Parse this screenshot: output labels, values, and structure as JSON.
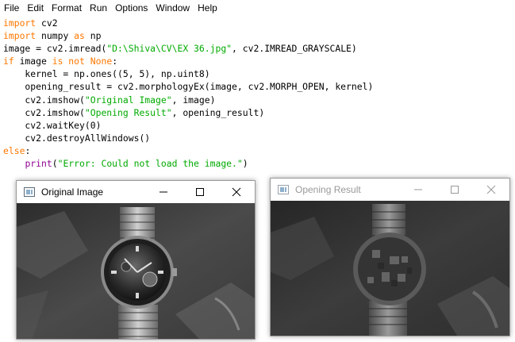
{
  "menubar": [
    "File",
    "Edit",
    "Format",
    "Run",
    "Options",
    "Window",
    "Help"
  ],
  "code": [
    [
      {
        "t": "import",
        "c": "kw"
      },
      {
        "t": " cv2"
      }
    ],
    [
      {
        "t": "import",
        "c": "kw"
      },
      {
        "t": " numpy "
      },
      {
        "t": "as",
        "c": "kw"
      },
      {
        "t": " np"
      }
    ],
    [
      {
        "t": "image = cv2.imread("
      },
      {
        "t": "\"D:\\Shiva\\CV\\EX 36.jpg\"",
        "c": "str"
      },
      {
        "t": ", cv2.IMREAD_GRAYSCALE)"
      }
    ],
    [
      {
        "t": "if",
        "c": "kw"
      },
      {
        "t": " image "
      },
      {
        "t": "is not",
        "c": "kw"
      },
      {
        "t": " "
      },
      {
        "t": "None",
        "c": "kw"
      },
      {
        "t": ":"
      }
    ],
    [
      {
        "t": "    kernel = np.ones((5, 5), np.uint8)"
      }
    ],
    [
      {
        "t": "    opening_result = cv2.morphologyEx(image, cv2.MORPH_OPEN, kernel)"
      }
    ],
    [
      {
        "t": "    cv2.imshow("
      },
      {
        "t": "\"Original Image\"",
        "c": "str"
      },
      {
        "t": ", image)"
      }
    ],
    [
      {
        "t": "    cv2.imshow("
      },
      {
        "t": "\"Opening Result\"",
        "c": "str"
      },
      {
        "t": ", opening_result)"
      }
    ],
    [
      {
        "t": "    cv2.waitKey(0)"
      }
    ],
    [
      {
        "t": "    cv2.destroyAllWindows()"
      }
    ],
    [
      {
        "t": "else",
        "c": "kw"
      },
      {
        "t": ":"
      }
    ],
    [
      {
        "t": "    "
      },
      {
        "t": "print",
        "c": "bi"
      },
      {
        "t": "("
      },
      {
        "t": "\"Error: Could not load the image.\"",
        "c": "str"
      },
      {
        "t": ")"
      }
    ]
  ],
  "windows": {
    "original": {
      "title": "Original Image"
    },
    "opening": {
      "title": "Opening Result"
    }
  },
  "colors": {
    "keyword": "#ff7700",
    "string": "#00aa00",
    "builtin": "#900090",
    "inactive_title": "#999999"
  },
  "icons": [
    "window-app-icon",
    "minimize-icon",
    "maximize-icon",
    "close-icon"
  ]
}
